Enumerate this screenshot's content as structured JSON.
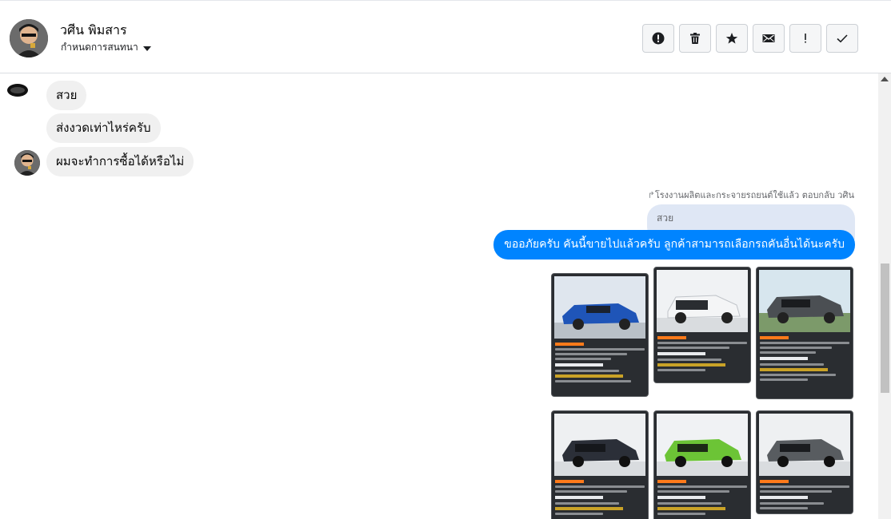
{
  "header": {
    "contact_name": "วศีน พิมสาร",
    "assign_label": "กำหนดการสนทนา",
    "actions": [
      {
        "name": "report-button",
        "icon": "alert-circle-icon"
      },
      {
        "name": "delete-button",
        "icon": "trash-icon"
      },
      {
        "name": "star-button",
        "icon": "star-icon"
      },
      {
        "name": "mark-unread-button",
        "icon": "envelope-icon"
      },
      {
        "name": "important-button",
        "icon": "exclamation-icon"
      },
      {
        "name": "done-button",
        "icon": "check-icon"
      }
    ]
  },
  "messages": {
    "in": [
      "สวย",
      "ส่งงวดเท่าไหร่ครับ",
      "ผมจะทำการซื้อได้หรือไม่"
    ],
    "reply_meta": "โรงงานผลิตและกระจายรถยนต์ใช้แล้ว ตอบกลับ วศิน",
    "quoted": "สวย",
    "out": "ขออภัยครับ คันนี้ขายไปแล้วครับ ลูกค้าสามารถเลือกรถคันอื่นได้นะครับ"
  },
  "colors": {
    "accent": "#0084ff",
    "incoming_bubble": "#f0f0f0",
    "quoted_bubble": "#dfe7f5"
  }
}
